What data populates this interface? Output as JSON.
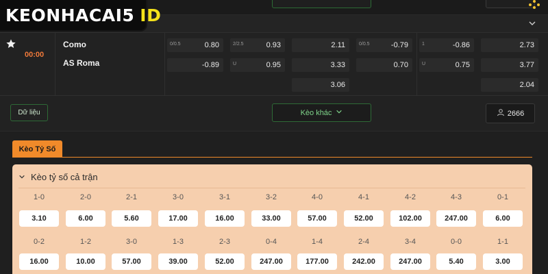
{
  "brand": {
    "part1": "KEONHACAI5",
    "part2": "ID"
  },
  "match": {
    "time": "00:00",
    "home": "Como",
    "away": "AS Roma",
    "odds": {
      "ah_home_label": "0/0.5",
      "ah_home": "0.80",
      "ah_away": "-0.89",
      "ou_over_label": "2/2.5",
      "ou_over": "0.93",
      "ou_under_label": "U",
      "ou_under": "0.95",
      "x12_home": "2.11",
      "x12_away": "3.33",
      "x12_draw": "3.06",
      "h1_ah_label": "0/0.5",
      "h1_ah_home": "-0.79",
      "h1_ah_away": "0.70",
      "h1_ou_over_label": "1",
      "h1_ou_over": "-0.86",
      "h1_ou_under_label": "U",
      "h1_ou_under": "0.75",
      "h1_x12_home": "2.73",
      "h1_x12_away": "3.77",
      "h1_x12_draw": "2.04"
    }
  },
  "actions": {
    "data_label": "Dữ liệu",
    "more_label": "Kèo khác",
    "count": "2666"
  },
  "tabs": {
    "active": "Kèo Tỷ Số"
  },
  "panel": {
    "title": "Kèo tỷ số cả trận",
    "row1": [
      {
        "score": "1-0",
        "odds": "3.10"
      },
      {
        "score": "2-0",
        "odds": "6.00"
      },
      {
        "score": "2-1",
        "odds": "5.60"
      },
      {
        "score": "3-0",
        "odds": "17.00"
      },
      {
        "score": "3-1",
        "odds": "16.00"
      },
      {
        "score": "3-2",
        "odds": "33.00"
      },
      {
        "score": "4-0",
        "odds": "57.00"
      },
      {
        "score": "4-1",
        "odds": "52.00"
      },
      {
        "score": "4-2",
        "odds": "102.00"
      },
      {
        "score": "4-3",
        "odds": "247.00"
      },
      {
        "score": "0-1",
        "odds": "6.00"
      }
    ],
    "row2": [
      {
        "score": "0-2",
        "odds": "16.00"
      },
      {
        "score": "1-2",
        "odds": "10.00"
      },
      {
        "score": "3-0",
        "odds": "57.00"
      },
      {
        "score": "1-3",
        "odds": "39.00"
      },
      {
        "score": "2-3",
        "odds": "52.00"
      },
      {
        "score": "0-4",
        "odds": "247.00"
      },
      {
        "score": "1-4",
        "odds": "177.00"
      },
      {
        "score": "2-4",
        "odds": "242.00"
      },
      {
        "score": "3-4",
        "odds": "247.00"
      },
      {
        "score": "0-0",
        "odds": "5.40"
      },
      {
        "score": "1-1",
        "odds": "3.00"
      }
    ]
  },
  "colors": {
    "accent_orange": "#f08a2a",
    "accent_green": "#2e6b36",
    "panel_bg": "#f6cfae"
  }
}
